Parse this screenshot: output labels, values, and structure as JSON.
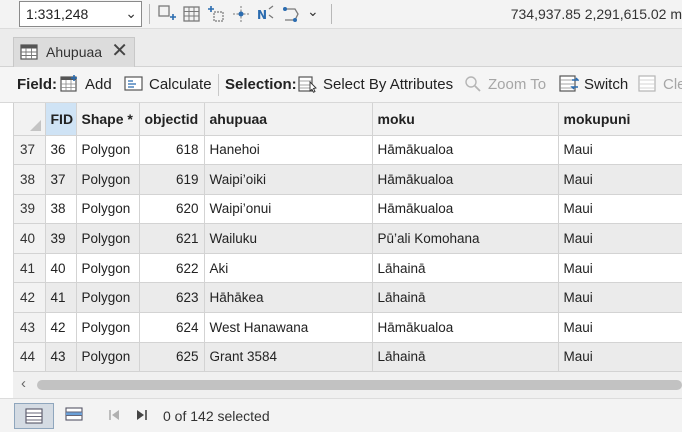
{
  "topbar": {
    "scale_value": "1:331,248",
    "coordinates": "734,937.85 2,291,615.02 m"
  },
  "tab": {
    "title": "Ahupuaa",
    "close_glyph": "✕"
  },
  "toolbar": {
    "field_label": "Field:",
    "add_label": "Add",
    "calculate_label": "Calculate",
    "selection_label": "Selection:",
    "select_by_attributes_label": "Select By Attributes",
    "zoom_to_label": "Zoom To",
    "switch_label": "Switch",
    "clear_label": "Cle"
  },
  "table": {
    "columns": [
      "FID",
      "Shape *",
      "objectid",
      "ahupuaa",
      "moku",
      "mokupuni"
    ],
    "rows": [
      {
        "row": "37",
        "fid": "36",
        "shape": "Polygon",
        "objectid": "618",
        "ahupuaa": "Hanehoi",
        "moku": "Hāmākualoa",
        "mokupuni": "Maui"
      },
      {
        "row": "38",
        "fid": "37",
        "shape": "Polygon",
        "objectid": "619",
        "ahupuaa": "Waipi’oiki",
        "moku": "Hāmākualoa",
        "mokupuni": "Maui"
      },
      {
        "row": "39",
        "fid": "38",
        "shape": "Polygon",
        "objectid": "620",
        "ahupuaa": "Waipi’onui",
        "moku": "Hāmākualoa",
        "mokupuni": "Maui"
      },
      {
        "row": "40",
        "fid": "39",
        "shape": "Polygon",
        "objectid": "621",
        "ahupuaa": "Wailuku",
        "moku": "Pū’ali Komohana",
        "mokupuni": "Maui"
      },
      {
        "row": "41",
        "fid": "40",
        "shape": "Polygon",
        "objectid": "622",
        "ahupuaa": "Aki",
        "moku": "Lāhainā",
        "mokupuni": "Maui"
      },
      {
        "row": "42",
        "fid": "41",
        "shape": "Polygon",
        "objectid": "623",
        "ahupuaa": "Hāhākea",
        "moku": "Lāhainā",
        "mokupuni": "Maui"
      },
      {
        "row": "43",
        "fid": "42",
        "shape": "Polygon",
        "objectid": "624",
        "ahupuaa": "West Hanawana",
        "moku": "Hāmākualoa",
        "mokupuni": "Maui"
      },
      {
        "row": "44",
        "fid": "43",
        "shape": "Polygon",
        "objectid": "625",
        "ahupuaa": "Grant 3584",
        "moku": "Lāhainā",
        "mokupuni": "Maui"
      },
      {
        "row": "",
        "fid": "",
        "shape": "",
        "objectid": "",
        "ahupuaa": "",
        "moku": "",
        "mokupuni": ""
      }
    ]
  },
  "footer": {
    "selection_count": "0 of 142 selected"
  },
  "icons": {
    "caret": "⌄",
    "scroll_left": "‹"
  },
  "colors": {
    "accent": "#2b6cb0",
    "fid_header": "#cfe3f5"
  }
}
